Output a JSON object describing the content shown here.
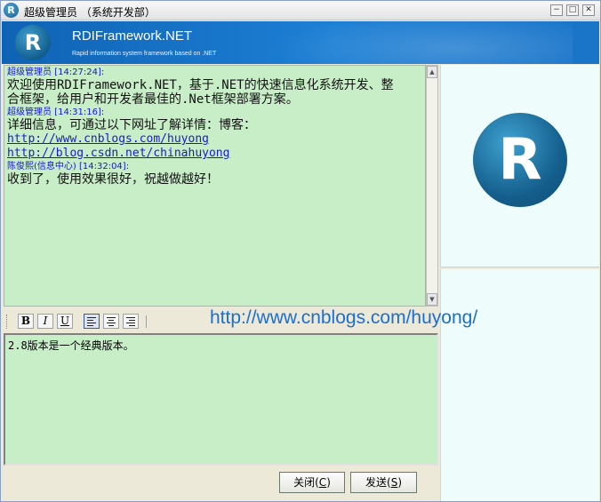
{
  "window": {
    "title": "超级管理员 （系统开发部）",
    "icon": "app-logo-icon",
    "controls": [
      "minimize-icon",
      "restore-icon",
      "close-icon"
    ]
  },
  "banner": {
    "logo_letter": "R",
    "title": "RDIFramework.NET",
    "subtitle": "Rapid information system framework based on .NET"
  },
  "messages": [
    {
      "header": "超级管理员 [14:27:24]:",
      "lines": [
        "欢迎使用RDIFramework.NET，基于.NET的快速信息化系统开发、整",
        "合框架，给用户和开发者最佳的.Net框架部署方案。"
      ],
      "links": []
    },
    {
      "header": "超级管理员 [14:31:16]:",
      "lines": [
        "详细信息，可通过以下网址了解详情：博客："
      ],
      "links": [
        "http://www.cnblogs.com/huyong",
        "http://blog.csdn.net/chinahuyong"
      ]
    },
    {
      "header": " 陈俊熙(信息中心) [14:32:04]:",
      "lines": [
        "收到了，使用效果很好，祝越做越好！"
      ],
      "links": []
    }
  ],
  "toolbar": {
    "bold": "B",
    "italic": "I",
    "underline": "U",
    "watermark_url": "http://www.cnblogs.com/huyong/"
  },
  "input": {
    "value": "2.8版本是一个经典版本。"
  },
  "buttons": {
    "close_label": "关闭(C)",
    "close_prefix": "关闭(",
    "close_key": "C",
    "close_suffix": ")",
    "send_prefix": "发送(",
    "send_key": "S",
    "send_suffix": ")"
  },
  "right_panel": {
    "logo_letter": "R"
  }
}
